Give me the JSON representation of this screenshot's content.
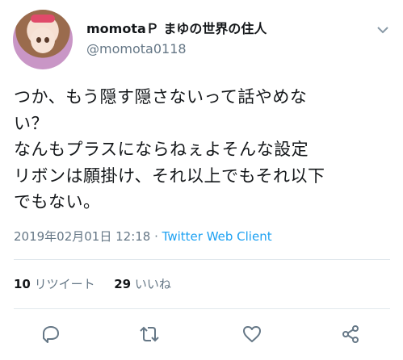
{
  "user": {
    "display_name": "momotaＰ まゆの世界の住人",
    "handle": "@momota0118"
  },
  "tweet": {
    "lines": [
      "つか、もう隠す隠さないって話やめな",
      "い？",
      "なんもプラスにならねぇよそんな設定",
      "リボンは願掛け、それ以上でもそれ以下",
      "でもない。"
    ],
    "timestamp": "2019年02月01日 12:18",
    "separator": " · ",
    "source": "Twitter Web Client"
  },
  "stats": {
    "retweets_count": "10",
    "retweets_label": "リツイート",
    "likes_count": "29",
    "likes_label": "いいね"
  },
  "icons": {
    "more": "chevron-down-icon",
    "reply": "reply-icon",
    "retweet": "retweet-icon",
    "like": "heart-icon",
    "share": "share-icon"
  },
  "colors": {
    "link": "#1da1f2",
    "secondary_text": "#657786",
    "primary_text": "#14171a"
  }
}
